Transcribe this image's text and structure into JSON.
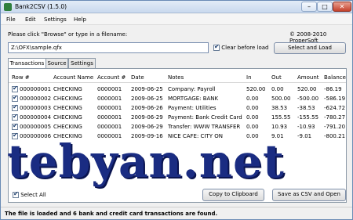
{
  "window": {
    "title": "Bank2CSV (1.5.0)",
    "btn_min": "–",
    "btn_max": "□",
    "btn_close": "✕"
  },
  "menu": [
    "File",
    "Edit",
    "Settings",
    "Help"
  ],
  "prompt": "Please click \"Browse\" or type in a filename:",
  "copyright": "© 2008-2010 ProperSoft",
  "file_input": {
    "value": "Z:\\OFX\\sample.qfx",
    "placeholder": ""
  },
  "clear_before_load": {
    "label": "Clear before load",
    "checked": true
  },
  "select_load_button": "Select and Load",
  "tabs": [
    "Transactions",
    "Source",
    "Settings"
  ],
  "table": {
    "headers": [
      "Row #",
      "Account Name",
      "Account #",
      "Date",
      "Notes",
      "In",
      "Out",
      "Amount",
      "Balance"
    ],
    "rows": [
      {
        "checked": true,
        "cells": [
          "000000001",
          "CHECKING",
          "0000001",
          "2009-06-25",
          "Company: Payroll",
          "520.00",
          "0.00",
          "520.00",
          "-86.19"
        ]
      },
      {
        "checked": true,
        "cells": [
          "000000002",
          "CHECKING",
          "0000001",
          "2009-06-25",
          "MORTGAGE: BANK",
          "0.00",
          "500.00",
          "-500.00",
          "-586.19"
        ]
      },
      {
        "checked": true,
        "cells": [
          "000000003",
          "CHECKING",
          "0000001",
          "2009-06-26",
          "Payment: Utilities",
          "0.00",
          "38.53",
          "-38.53",
          "-624.72"
        ]
      },
      {
        "checked": true,
        "cells": [
          "000000004",
          "CHECKING",
          "0000001",
          "2009-06-29",
          "Payment: Bank Credit Card",
          "0.00",
          "155.55",
          "-155.55",
          "-780.27"
        ]
      },
      {
        "checked": true,
        "cells": [
          "000000005",
          "CHECKING",
          "0000001",
          "2009-06-29",
          "Transfer: WWW TRANSFER",
          "0.00",
          "10.93",
          "-10.93",
          "-791.20"
        ]
      },
      {
        "checked": true,
        "cells": [
          "000000006",
          "CHECKING",
          "0000001",
          "2009-09-16",
          "NICE CAFE: CITY ON",
          "0.00",
          "9.01",
          "-9.01",
          "-800.21"
        ]
      }
    ]
  },
  "select_all": {
    "label": "Select All",
    "checked": true
  },
  "copy_button": "Copy to Clipboard",
  "save_button": "Save as CSV and Open",
  "status": "The file is loaded and 6 bank and credit card transactions are found.",
  "watermark": "tebyan.net"
}
